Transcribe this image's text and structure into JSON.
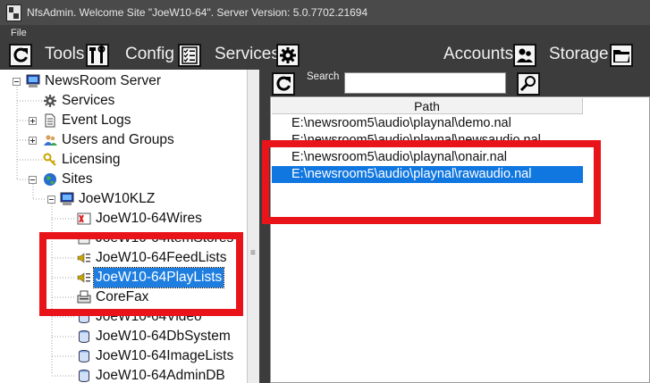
{
  "window": {
    "title": "NfsAdmin. Welcome Site \"JoeW10-64\". Server Version: 5.0.7702.21694"
  },
  "menu": {
    "file": "File"
  },
  "toolbar": {
    "tools": "Tools",
    "config": "Config",
    "services": "Services",
    "accounts": "Accounts",
    "storage": "Storage"
  },
  "tree": {
    "root": "NewsRoom Server",
    "services": "Services",
    "event_logs": "Event Logs",
    "users_groups": "Users and Groups",
    "licensing": "Licensing",
    "sites": "Sites",
    "site": "JoeW10KLZ",
    "children": [
      "JoeW10-64Wires",
      "JoeW10-64ItemStores",
      "JoeW10-64FeedLists",
      "JoeW10-64PlayLists",
      "CoreFax",
      "JoeW10-64Video",
      "JoeW10-64DbSystem",
      "JoeW10-64ImageLists",
      "JoeW10-64AdminDB"
    ],
    "selected": "JoeW10-64PlayLists"
  },
  "search": {
    "label": "Search",
    "value": ""
  },
  "list": {
    "column": "Path",
    "rows": [
      "E:\\newsroom5\\audio\\playnal\\demo.nal",
      "E:\\newsroom5\\audio\\playnal\\newsaudio.nal",
      "E:\\newsroom5\\audio\\playnal\\onair.nal",
      "E:\\newsroom5\\audio\\playnal\\rawaudio.nal"
    ],
    "selected": "E:\\newsroom5\\audio\\playnal\\rawaudio.nal"
  },
  "colors": {
    "highlight_box": "#e8141a",
    "selection": "#1e7ee0",
    "chrome": "#3c3c3c"
  }
}
